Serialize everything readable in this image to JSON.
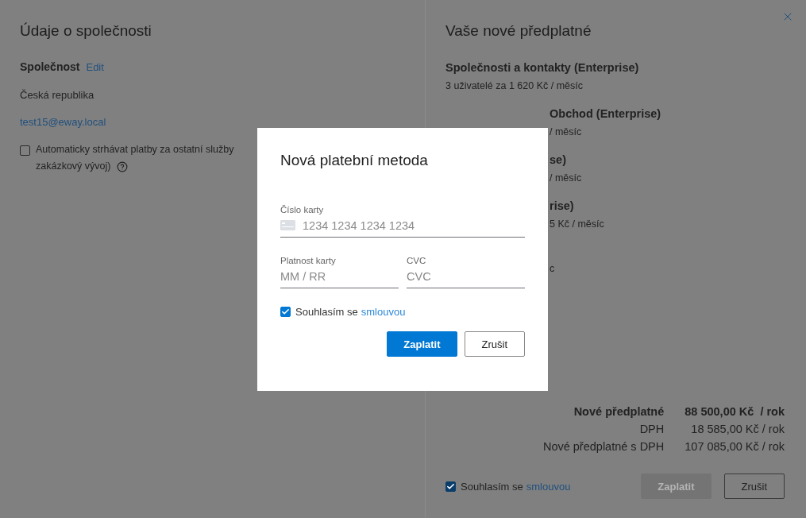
{
  "left_panel": {
    "title": "Údaje o společnosti",
    "company": {
      "label": "Společnost",
      "edit_link": "Edit"
    },
    "country": "Česká republika",
    "email": "test15@eway.local",
    "auto_payment": {
      "checked": false,
      "label_lines": [
        "Automaticky strhávat platby za ostatní služby",
        "zakázkový vývoj)"
      ]
    }
  },
  "right_panel": {
    "title": "Vaše nové předplatné",
    "items": [
      {
        "title": "Společnosti a kontakty (Enterprise)",
        "subtitle": "3 uživatelé za 1 620 Kč / měsíc",
        "covered": false
      },
      {
        "title": "Obchod (Enterprise)",
        "subtitle": "/ měsíc",
        "covered": true
      },
      {
        "title": "se)",
        "subtitle": "/ měsíc",
        "covered": true
      },
      {
        "title": "rise)",
        "subtitle": "5 Kč / měsíc",
        "covered": true
      },
      {
        "subtitle": "c",
        "covered": true
      }
    ],
    "totals": [
      {
        "label": "Nové předplatné",
        "amount": "88 500,00 Kč  / rok",
        "bold": true
      },
      {
        "label": "DPH",
        "amount": "18 585,00 Kč / rok",
        "bold": false
      },
      {
        "label": "Nové předplatné s DPH",
        "amount": "107 085,00 Kč / rok",
        "bold": false
      }
    ],
    "agreement": {
      "checked": true,
      "text": "Souhlasím se",
      "link": "smlouvou"
    },
    "buttons": [
      {
        "label": "Zaplatit",
        "kind": "primary",
        "disabled": true
      },
      {
        "label": "Zrušit",
        "kind": "secondary"
      }
    ]
  },
  "modal": {
    "title": "Nová platební metoda",
    "card_number": {
      "label": "Číslo karty",
      "placeholder": "1234 1234 1234 1234"
    },
    "expiry": {
      "label": "Platnost karty",
      "placeholder": "MM / RR"
    },
    "cvc": {
      "label": "CVC",
      "placeholder": "CVC"
    },
    "agreement": {
      "checked": true,
      "text": "Souhlasím se",
      "link": "smlouvou"
    },
    "buttons": [
      {
        "label": "Zaplatit",
        "kind": "primary",
        "disabled": false
      },
      {
        "label": "Zrušit",
        "kind": "secondary"
      }
    ]
  }
}
